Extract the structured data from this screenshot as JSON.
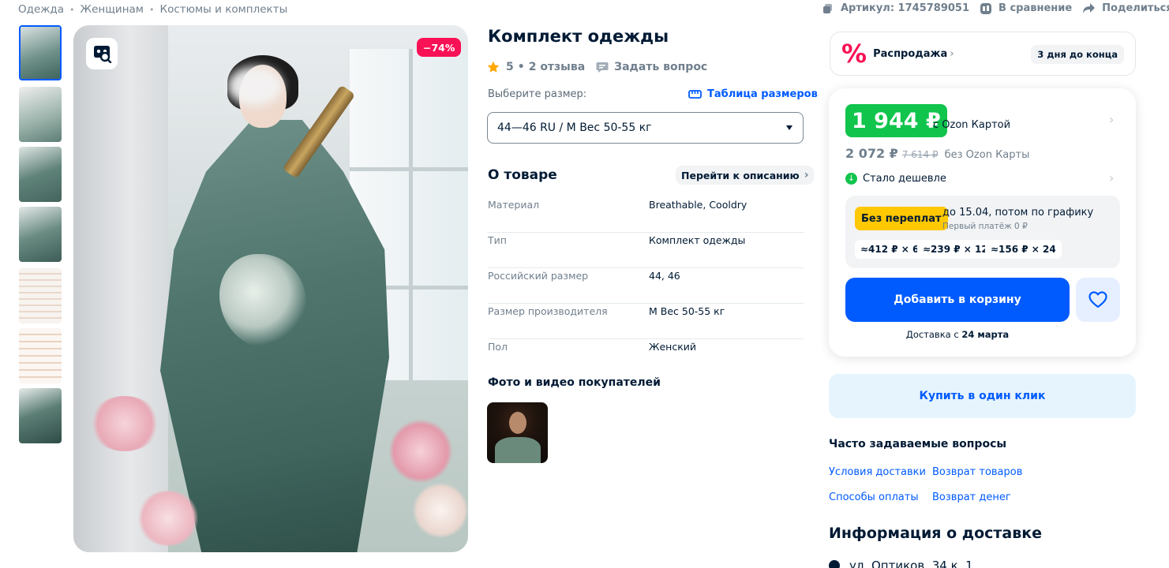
{
  "breadcrumb": [
    "Одежда",
    "Женщинам",
    "Костюмы и комплекты"
  ],
  "top_actions": {
    "article": "Артикул: 1745789051",
    "compare": "В сравнение",
    "share": "Поделиться"
  },
  "gallery": {
    "thumbnail_count": 7,
    "selected_index": 0,
    "discount_badge": "−74%"
  },
  "product": {
    "title": "Комплект одежды",
    "rating": "5",
    "reviews": "2 отзыва",
    "ask_question": "Задать вопрос"
  },
  "size": {
    "label": "Выберите размер:",
    "table_link": "Таблица размеров",
    "selected": "44—46 RU / M Вес 50-55 кг"
  },
  "about": {
    "title": "О товаре",
    "to_description": "Перейти к описанию",
    "specs": [
      {
        "key": "Материал",
        "value": "Breathable, Cooldry"
      },
      {
        "key": "Тип",
        "value": "Комплект одежды"
      },
      {
        "key": "Российский размер",
        "value": "44, 46"
      },
      {
        "key": "Размер производителя",
        "value": "M Вес 50-55 кг"
      },
      {
        "key": "Пол",
        "value": "Женский"
      }
    ]
  },
  "customer_photos": {
    "title": "Фото и видео покупателей"
  },
  "sale": {
    "icon": "%",
    "label": "Распродажа",
    "days_left": "3 дня до конца"
  },
  "price": {
    "ozon_card_price": "1 944 ₽",
    "ozon_card_label": "с Ozon Картой",
    "regular_price": "2 072 ₽",
    "old_price": "7 614 ₽",
    "regular_label": "без Ozon Карты",
    "cheaper_label": "Стало дешевле"
  },
  "installment": {
    "badge": "Без переплат",
    "line1": "до 15.04, потом по графику",
    "line2": "Первый платёж 0 ₽",
    "options": [
      "≈412 ₽ × 6",
      "≈239 ₽ × 12",
      "≈156 ₽ × 24"
    ]
  },
  "actions": {
    "add_to_cart": "Добавить в корзину",
    "delivery_prefix": "Доставка с ",
    "delivery_date": "24 марта",
    "buy_one_click": "Купить в один клик"
  },
  "faq": {
    "title": "Часто задаваемые вопросы",
    "links": [
      "Условия доставки",
      "Возврат товаров",
      "Способы оплаты",
      "Возврат денег"
    ]
  },
  "delivery_info": {
    "title": "Информация о доставке",
    "address": "ул. Оптиков, 34 к. 1"
  },
  "colors": {
    "accent_blue": "#005bff",
    "sale_pink": "#f91155",
    "price_green": "#10c44c",
    "installment_yellow": "#ffc800"
  }
}
